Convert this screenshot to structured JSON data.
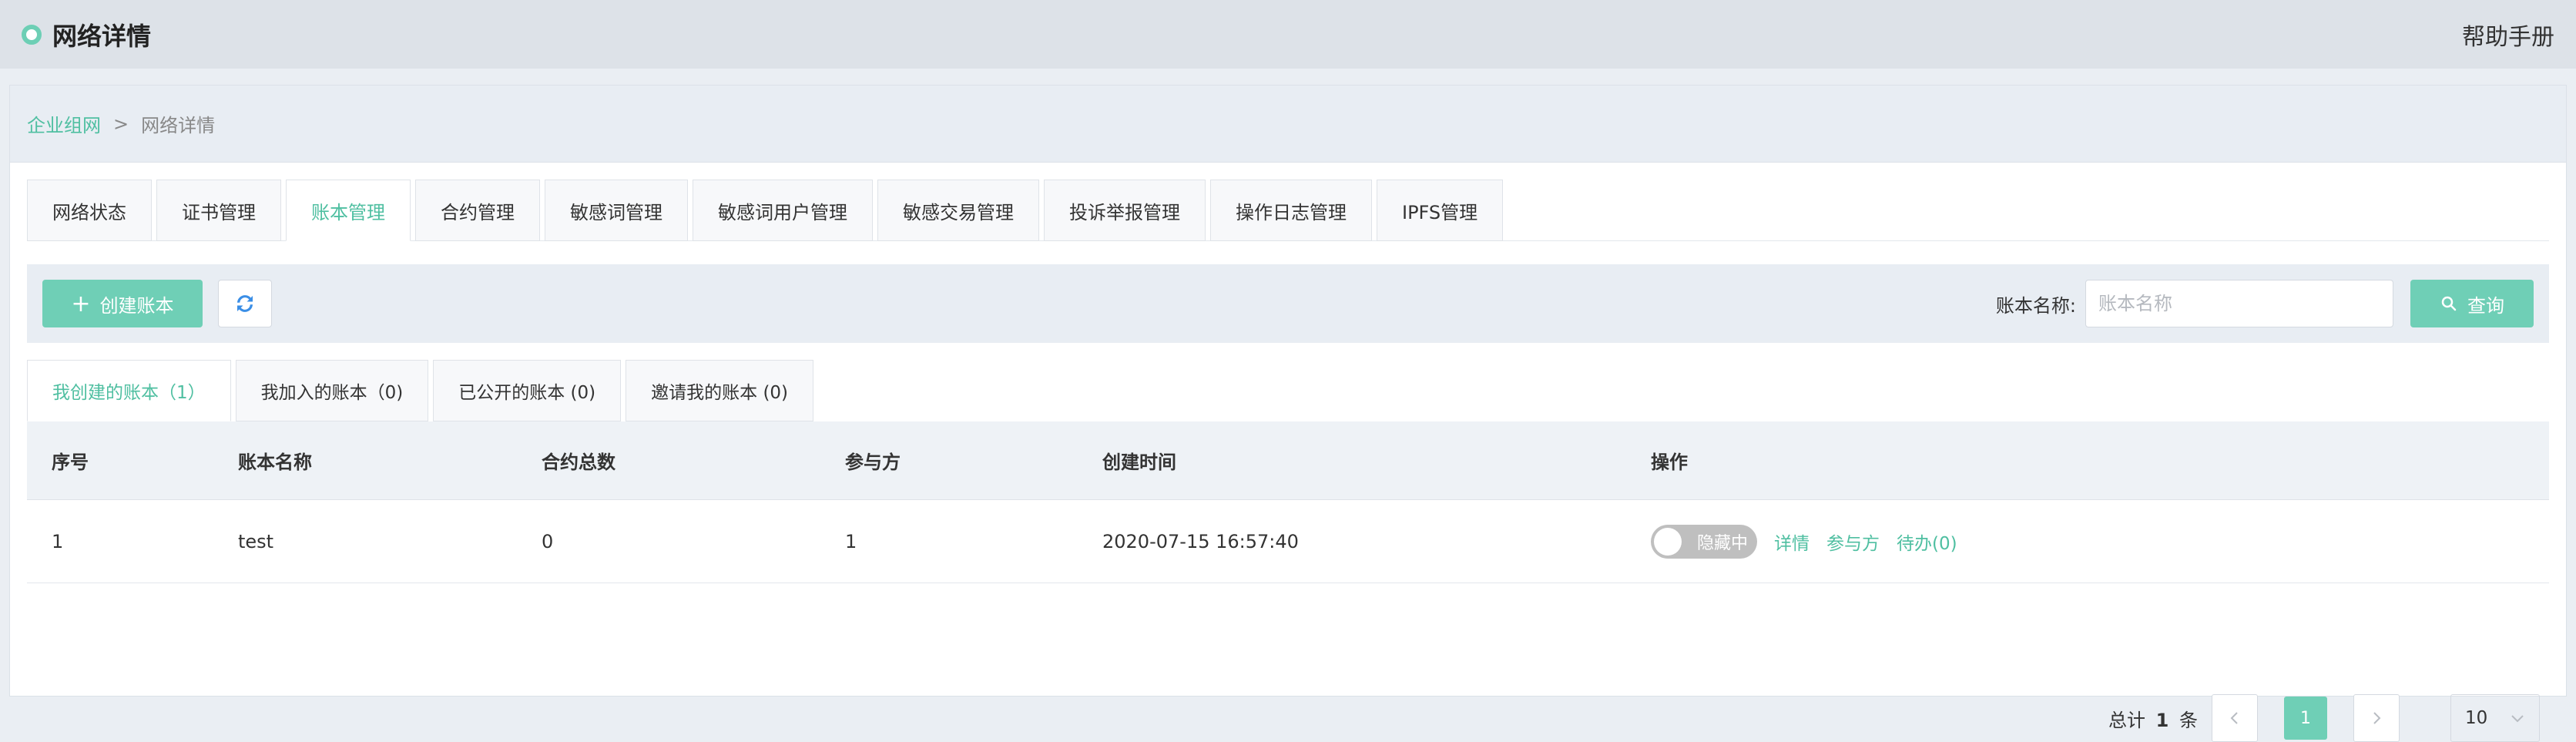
{
  "header": {
    "title": "网络详情",
    "help": "帮助手册"
  },
  "breadcrumb": {
    "parent": "企业组网",
    "separator": ">",
    "current": "网络详情"
  },
  "tabs": [
    {
      "label": "网络状态"
    },
    {
      "label": "证书管理"
    },
    {
      "label": "账本管理",
      "active": true
    },
    {
      "label": "合约管理"
    },
    {
      "label": "敏感词管理"
    },
    {
      "label": "敏感词用户管理"
    },
    {
      "label": "敏感交易管理"
    },
    {
      "label": "投诉举报管理"
    },
    {
      "label": "操作日志管理"
    },
    {
      "label": "IPFS管理"
    }
  ],
  "toolbar": {
    "create_label": "创建账本",
    "search_label": "账本名称:",
    "search_placeholder": "账本名称",
    "search_button": "查询"
  },
  "subtabs": [
    {
      "label": "我创建的账本（1）",
      "active": true
    },
    {
      "label": "我加入的账本（0)"
    },
    {
      "label": "已公开的账本 (0)"
    },
    {
      "label": "邀请我的账本 (0)"
    }
  ],
  "table": {
    "columns": [
      "序号",
      "账本名称",
      "合约总数",
      "参与方",
      "创建时间",
      "操作"
    ],
    "rows": [
      {
        "index": "1",
        "name": "test",
        "contracts": "0",
        "participants": "1",
        "created": "2020-07-15 16:57:40",
        "toggle_label": "隐藏中",
        "actions": [
          "详情",
          "参与方",
          "待办(0)"
        ]
      }
    ]
  },
  "pagination": {
    "total_prefix": "总计",
    "total_count": "1",
    "total_suffix": "条",
    "current_page": "1",
    "page_size": "10"
  },
  "colors": {
    "accent": "#6fcfb6",
    "accent_text": "#4fbfa1"
  }
}
